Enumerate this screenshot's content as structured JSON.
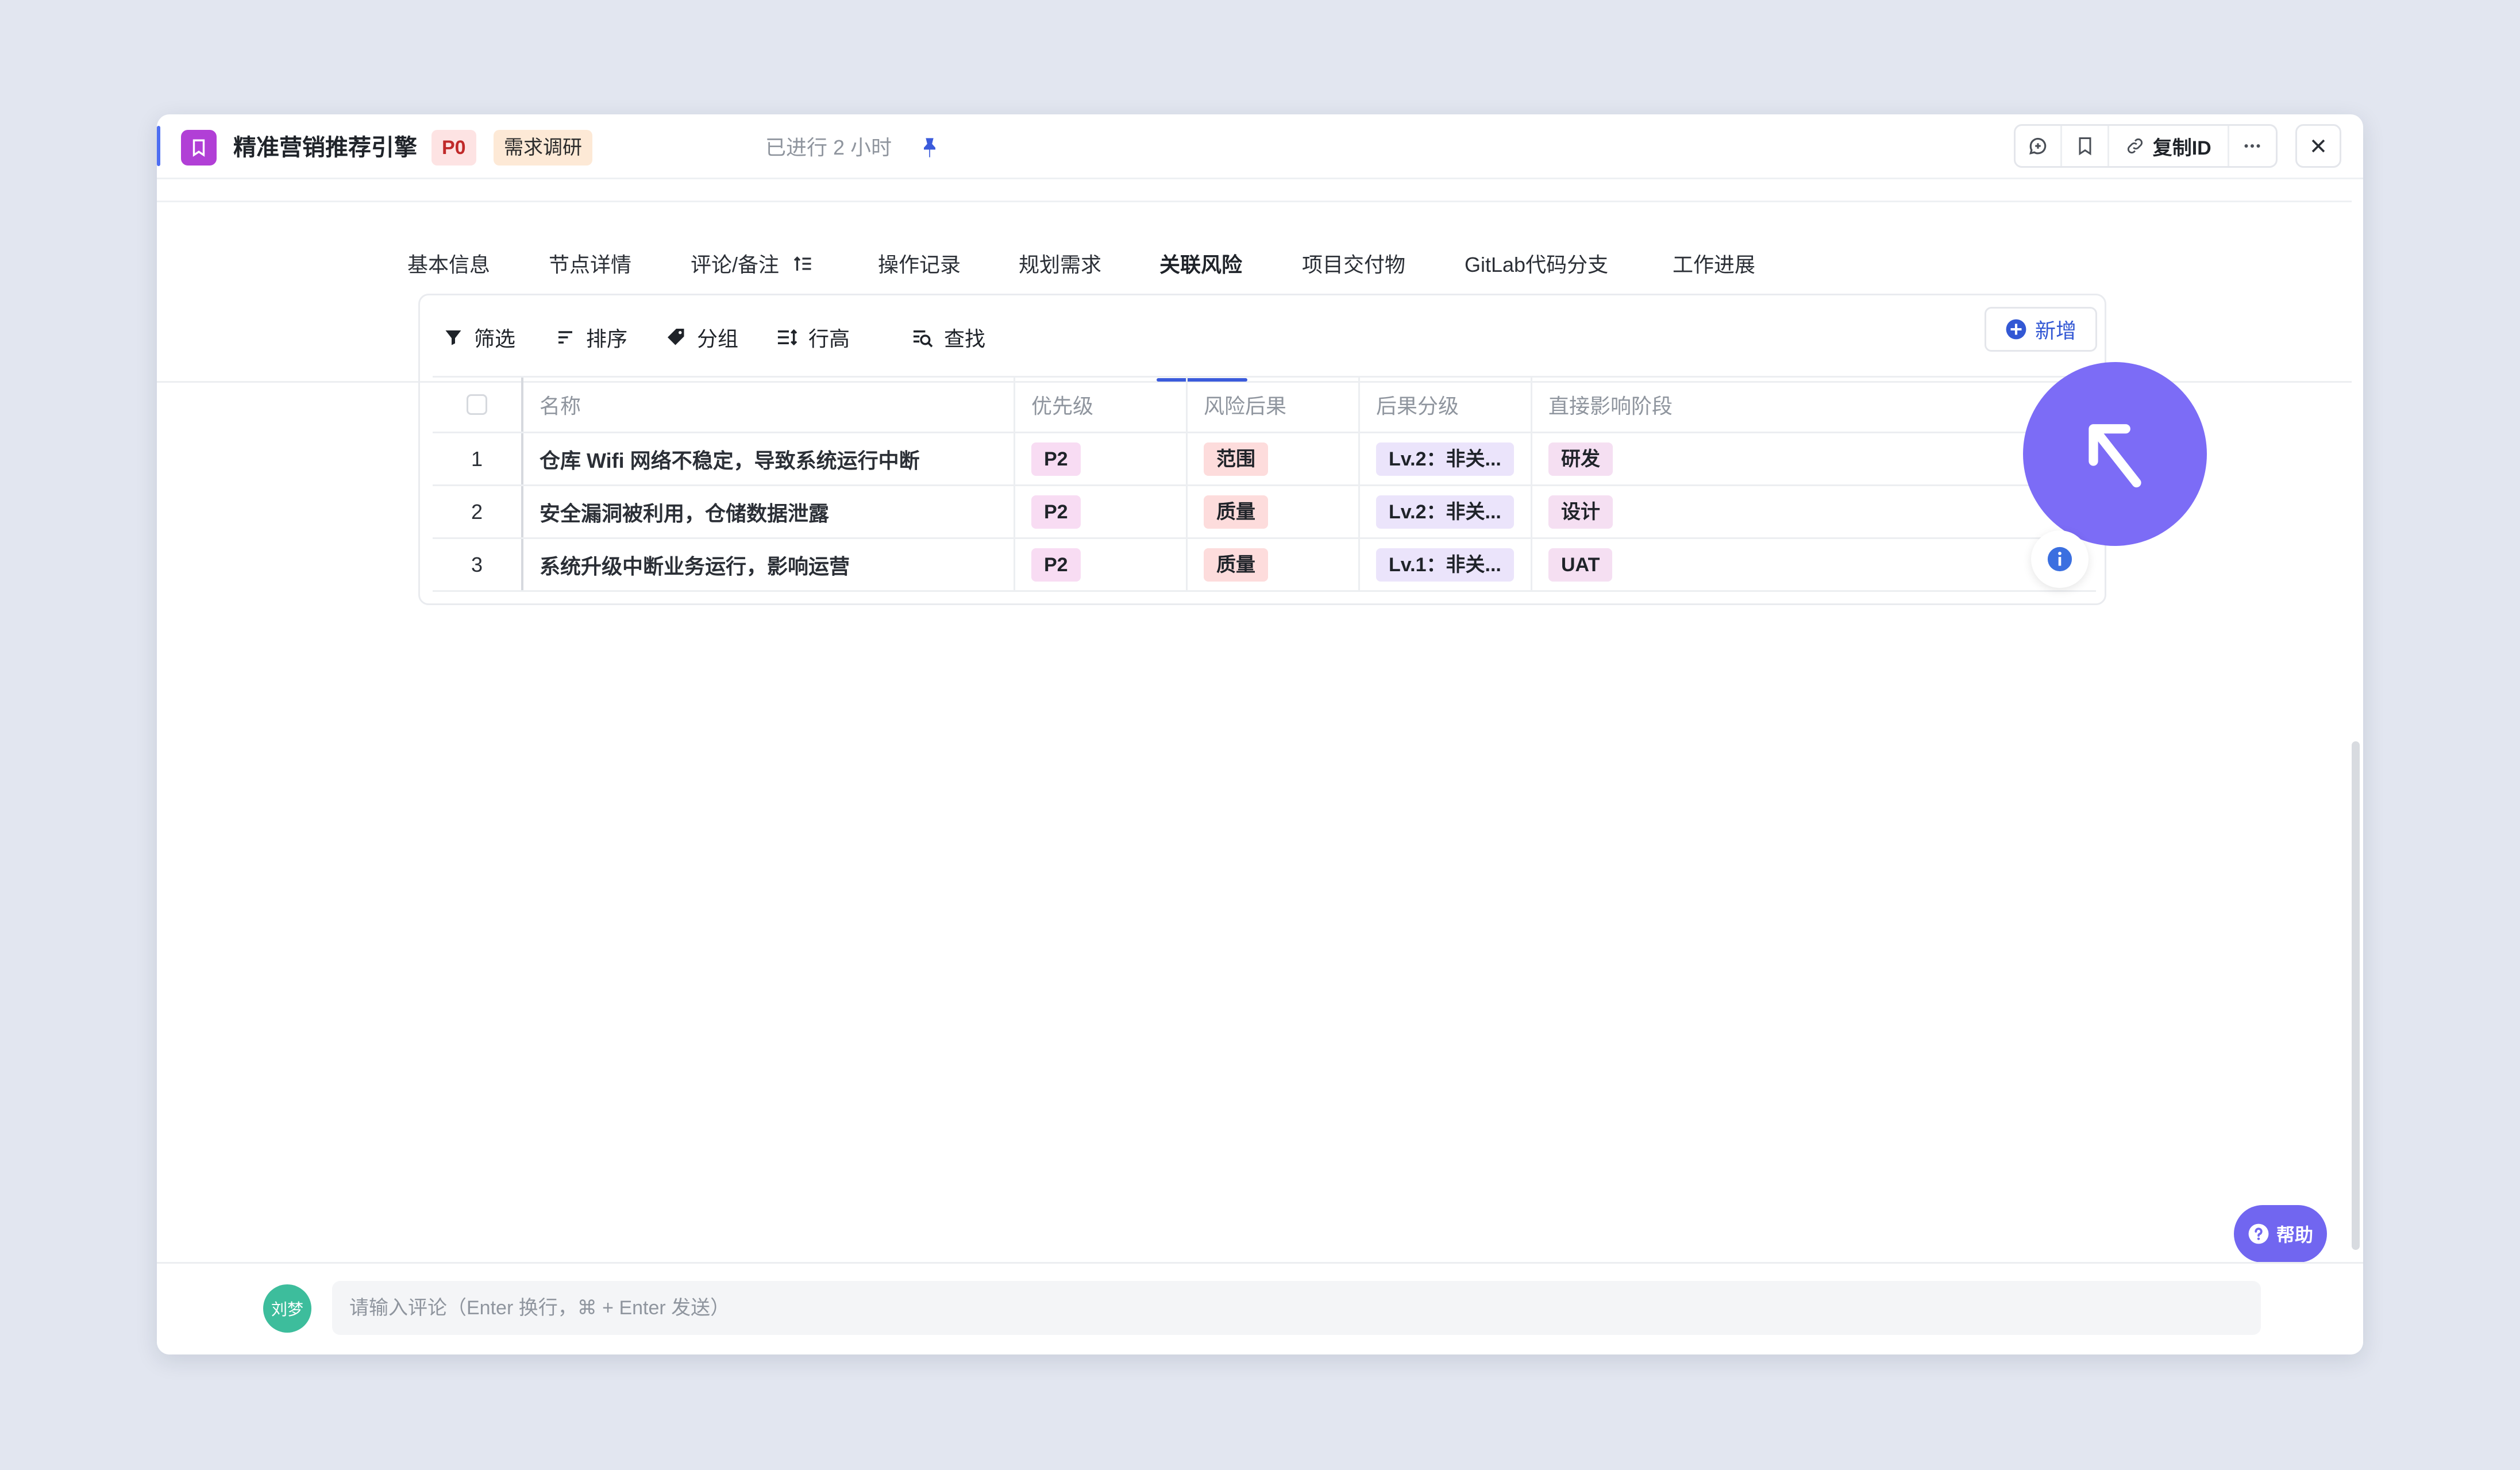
{
  "header": {
    "title": "精准营销推荐引擎",
    "priority_badge": "P0",
    "stage_badge": "需求调研",
    "elapsed": "已进行 2 小时",
    "copy_id_label": "复制ID"
  },
  "tabs": [
    {
      "label": "基本信息"
    },
    {
      "label": "节点详情"
    },
    {
      "label": "评论/备注"
    },
    {
      "label": "操作记录"
    },
    {
      "label": "规划需求"
    },
    {
      "label": "关联风险",
      "active": true
    },
    {
      "label": "项目交付物"
    },
    {
      "label": "GitLab代码分支"
    },
    {
      "label": "工作进展"
    }
  ],
  "filterbar": {
    "filter": "筛选",
    "sort": "排序",
    "group": "分组",
    "row_height": "行高",
    "find": "查找",
    "add": "新增"
  },
  "table": {
    "columns": [
      "名称",
      "优先级",
      "风险后果",
      "后果分级",
      "直接影响阶段"
    ],
    "rows": [
      {
        "index": "1",
        "name": "仓库 Wifi 网络不稳定，导致系统运行中断",
        "priority": "P2",
        "consequence": "范围",
        "level": "Lv.2：非关...",
        "stage": "研发"
      },
      {
        "index": "2",
        "name": "安全漏洞被利用，仓储数据泄露",
        "priority": "P2",
        "consequence": "质量",
        "level": "Lv.2：非关...",
        "stage": "设计"
      },
      {
        "index": "3",
        "name": "系统升级中断业务运行，影响运营",
        "priority": "P2",
        "consequence": "质量",
        "level": "Lv.1：非关...",
        "stage": "UAT"
      }
    ]
  },
  "help": {
    "label": "帮助"
  },
  "comment": {
    "avatar_text": "刘梦",
    "placeholder": "请输入评论（Enter 换行，⌘ + Enter 发送）"
  },
  "colors": {
    "accent": "#3b5bdb",
    "cursor_badge": "#7c6cf6",
    "help_button": "#7166f0",
    "app_icon": "#b13fd6"
  }
}
